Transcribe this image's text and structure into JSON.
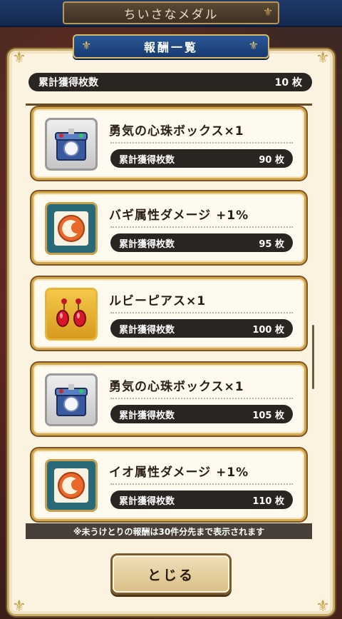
{
  "top_title": "ちいさなメダル",
  "panel_title": "報酬一覧",
  "total": {
    "label": "累計獲得枚数",
    "value": "10 枚"
  },
  "rewards": [
    {
      "name": "勇気の心珠ボックス×1",
      "req_label": "累計獲得枚数",
      "req_value": "90 枚",
      "icon": "treasure-box-icon"
    },
    {
      "name": "バギ属性ダメージ +1%",
      "req_label": "累計獲得枚数",
      "req_value": "95 枚",
      "icon": "orb-icon"
    },
    {
      "name": "ルビーピアス×1",
      "req_label": "累計獲得枚数",
      "req_value": "100 枚",
      "icon": "earring-icon"
    },
    {
      "name": "勇気の心珠ボックス×1",
      "req_label": "累計獲得枚数",
      "req_value": "105 枚",
      "icon": "treasure-box-icon"
    },
    {
      "name": "イオ属性ダメージ +1%",
      "req_label": "累計獲得枚数",
      "req_value": "110 枚",
      "icon": "orb-icon"
    }
  ],
  "note": "※未うけとりの報酬は30件分先まで表示されます",
  "close_label": "とじる",
  "colors": {
    "accent_blue": "#1e3a6a",
    "gold": "#d4a74a",
    "pill_dark": "#2a2521"
  }
}
